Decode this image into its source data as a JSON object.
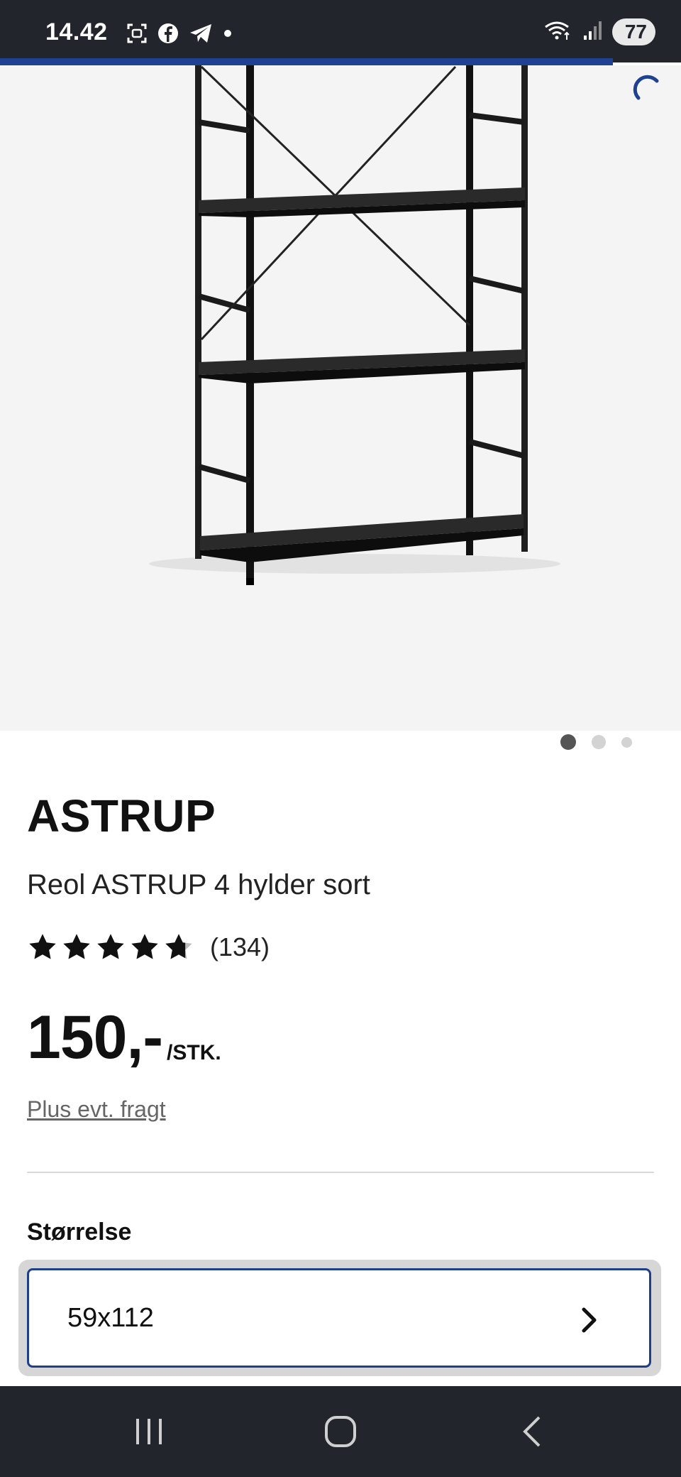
{
  "status_bar": {
    "time": "14.42",
    "battery": "77",
    "left_icons": [
      "screenshot-icon",
      "facebook-icon",
      "telegram-icon",
      "notification-dot-icon"
    ],
    "right_icons": [
      "wifi-icon",
      "signal-icon",
      "battery-icon"
    ]
  },
  "page_load_progress": 0.9,
  "carousel": {
    "image_description_icon": "shelf-product-image",
    "active_index": 0,
    "count": 3
  },
  "product": {
    "brand": "ASTRUP",
    "title": "Reol ASTRUP 4 hylder sort",
    "rating": 4.7,
    "review_count": "(134)",
    "price": "150,-",
    "unit": "/STK.",
    "freight_link": "Plus evt. fragt"
  },
  "size": {
    "label": "Størrelse",
    "value": "59x112"
  },
  "colors": {
    "accent": "#1f4191",
    "status_bar": "#22252c",
    "hero_bg": "#f4f4f4"
  }
}
